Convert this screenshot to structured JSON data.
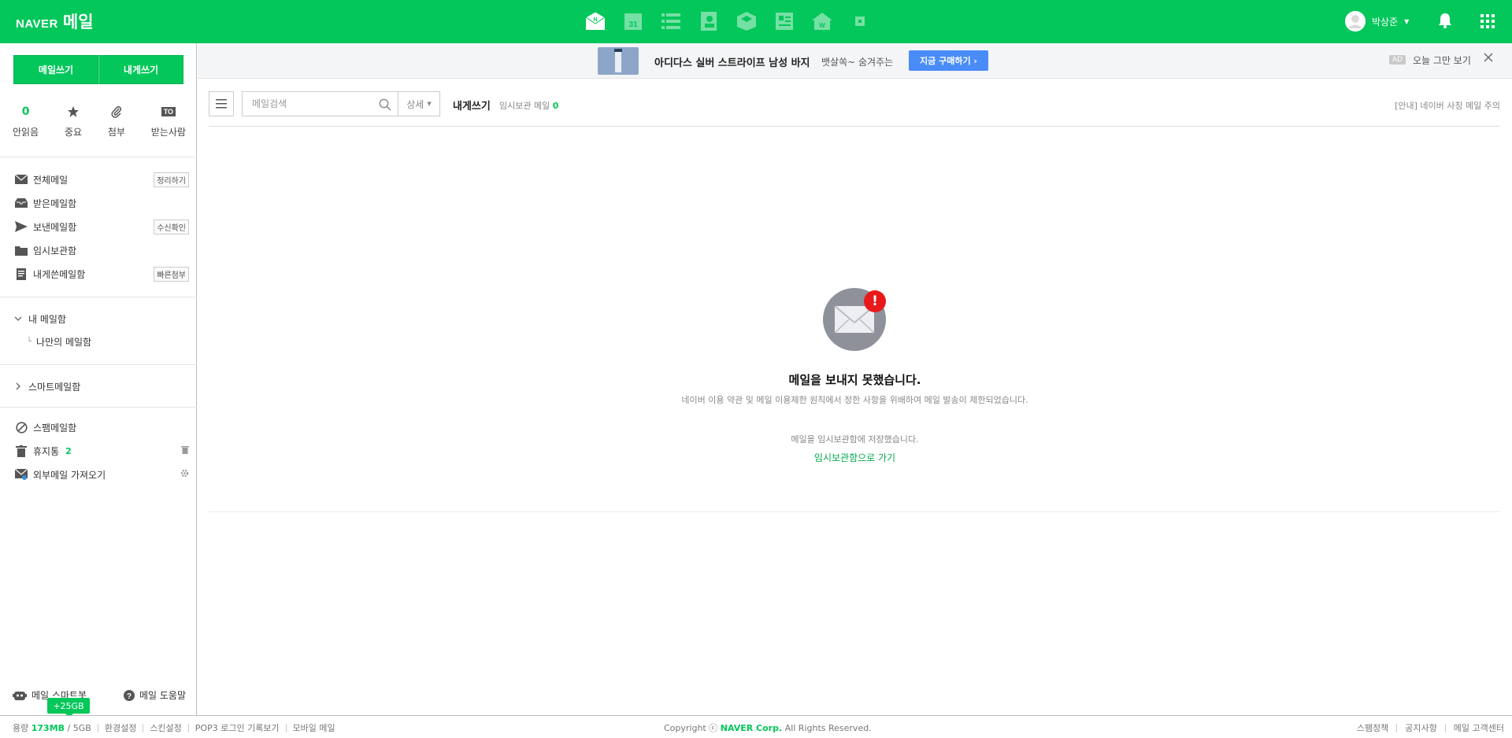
{
  "header": {
    "logo_naver": "NAVER",
    "logo_mail": "메일",
    "apps": [
      "mail-icon",
      "calendar-icon",
      "list-icon",
      "contacts-icon",
      "box-icon",
      "memo-icon",
      "house-icon",
      "mini-icon"
    ],
    "user_name": "박상준"
  },
  "sidebar": {
    "write_label": "메일쓰기",
    "self_write_label": "내게쓰기",
    "quick": {
      "unread_count": "0",
      "unread_label": "안읽음",
      "important_label": "중요",
      "attach_label": "첨부",
      "to_tag": "TO",
      "recipient_label": "받는사람"
    },
    "folders": {
      "all": "전체메일",
      "all_badge": "정리하기",
      "inbox": "받은메일함",
      "sent": "보낸메일함",
      "sent_badge": "수신확인",
      "drafts": "임시보관함",
      "self": "내게쓴메일함",
      "self_badge": "빠른첨부",
      "my_folders": "내 메일함",
      "my_sub": "나만의 메일함",
      "smart": "스마트메일함",
      "spam": "스팸메일함",
      "trash": "휴지통",
      "trash_count": "2",
      "external": "외부메일 가져오기"
    },
    "bottom": {
      "bot": "메일 스마트봇",
      "help": "메일 도움말",
      "tooltip": "+25GB"
    }
  },
  "ad": {
    "title": "아디다스 실버 스트라이프 남성 바지",
    "desc": "뱃살쏙~ 숨겨주는",
    "cta": "지금 구매하기 ›",
    "tag": "AD",
    "hide": "오늘 그만 보기"
  },
  "toolbar": {
    "search_placeholder": "메일검색",
    "detail": "상세",
    "title": "내게쓰기",
    "draft_label": "임시보관 메일",
    "draft_count": "0",
    "notice": "[안내] 네이버 사칭 메일 주의"
  },
  "message": {
    "title": "메일을 보내지 못했습니다.",
    "desc": "네이버 이용 약관 및 메일 이용제한 원칙에서 정한 사항을 위배하여 메일 발송이 제한되었습니다.",
    "saved": "메일을 임시보관함에 저장했습니다.",
    "link": "임시보관함으로 가기"
  },
  "footer": {
    "quota_label": "용량",
    "quota_used": "173MB",
    "quota_total": "/ 5GB",
    "settings": "환경설정",
    "skin": "스킨설정",
    "pop3": "POP3 로그인 기록보기",
    "mobile": "모바일 메일",
    "copy_pre": "Copyright ⓒ",
    "copy_corp": "NAVER Corp.",
    "copy_post": "All Rights Reserved.",
    "spam_policy": "스팸정책",
    "notice": "공지사항",
    "support": "메일 고객센터"
  }
}
